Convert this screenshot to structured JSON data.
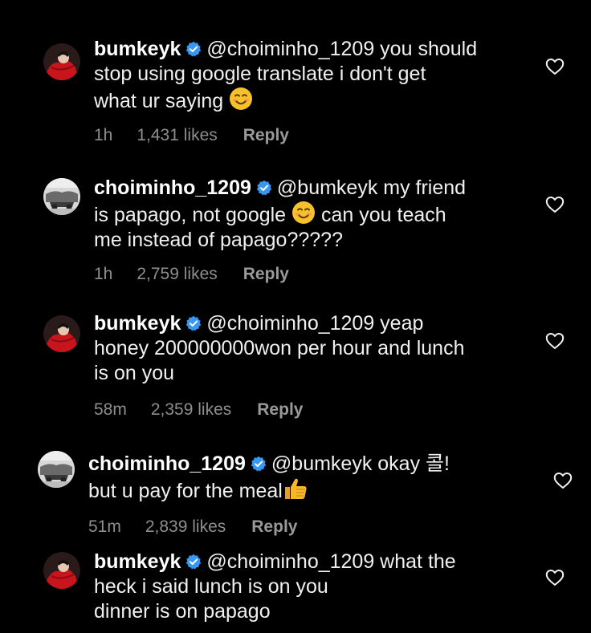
{
  "colors": {
    "background": "#000000",
    "verified_badge": "#3897f0",
    "meta_text": "#8e8e8e",
    "heart_outline": "#f2f2f2"
  },
  "comments": [
    {
      "username": "bumkeyk",
      "lines": [
        "@choiminho_1209 you should",
        "stop using google translate i don't get",
        "what ur saying"
      ],
      "emoji_end": "smiling-face-emoji",
      "time": "1h",
      "likes": "1,431 likes",
      "reply_label": "Reply",
      "avatar": "red-profile-avatar"
    },
    {
      "username": "choiminho_1209",
      "lines": [
        "@bumkeyk my friend",
        "is papago, not google",
        "can you teach",
        "me instead of papago?????"
      ],
      "time": "1h",
      "likes": "2,759 likes",
      "reply_label": "Reply",
      "avatar": "grey-profile-avatar"
    },
    {
      "username": "bumkeyk",
      "lines": [
        "@choiminho_1209 yeap",
        "honey 200000000won per hour and lunch",
        "is on you"
      ],
      "time": "58m",
      "likes": "2,359 likes",
      "reply_label": "Reply",
      "avatar": "red-profile-avatar"
    },
    {
      "username": "choiminho_1209",
      "lines": [
        "@bumkeyk okay 콜!",
        "but u pay for the meal"
      ],
      "emoji_end": "thumbs-up-emoji",
      "time": "51m",
      "likes": "2,839 likes",
      "reply_label": "Reply",
      "avatar": "grey-profile-avatar"
    },
    {
      "username": "bumkeyk",
      "lines": [
        "@choiminho_1209 what the",
        "heck i said lunch is on you",
        "dinner is on papago"
      ],
      "avatar": "red-profile-avatar"
    }
  ]
}
